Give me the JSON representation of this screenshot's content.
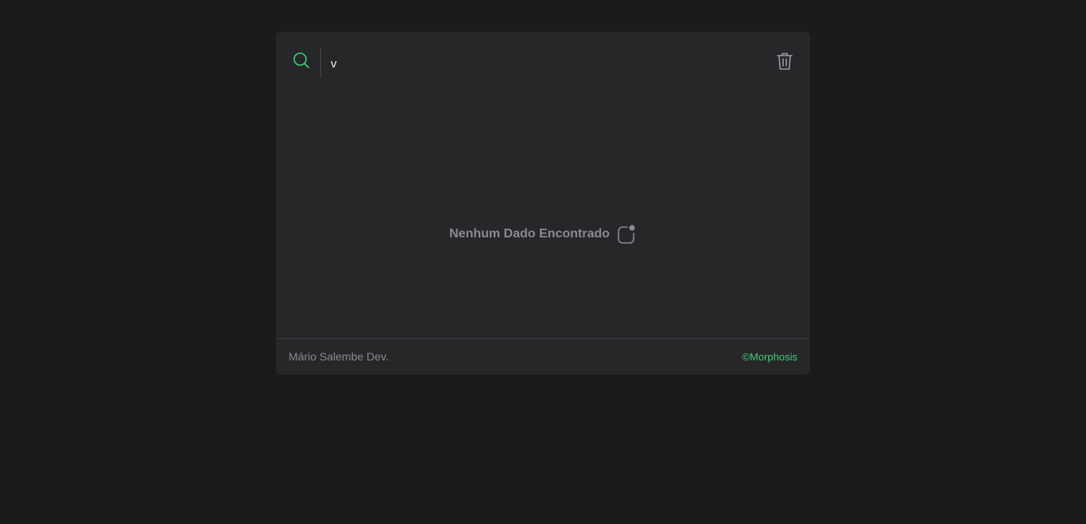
{
  "search": {
    "value": "v",
    "icon": "search-icon",
    "clear_icon": "trash-icon"
  },
  "empty_state": {
    "message": "Nenhum Dado Encontrado",
    "icon": "notification-box-icon"
  },
  "footer": {
    "author": "Mário Salembe Dev.",
    "brand": "©Morphosis"
  },
  "colors": {
    "background": "#1b1b1d",
    "panel": "#27272a",
    "accent": "#3ecf74",
    "muted_text": "#8a8a90"
  }
}
